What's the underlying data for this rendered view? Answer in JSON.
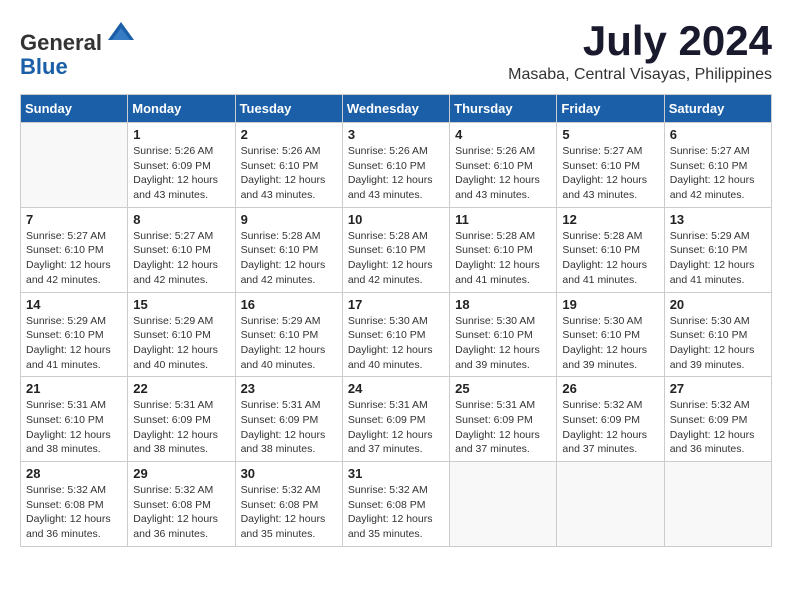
{
  "header": {
    "logo_line1": "General",
    "logo_line2": "Blue",
    "month_title": "July 2024",
    "location": "Masaba, Central Visayas, Philippines"
  },
  "weekdays": [
    "Sunday",
    "Monday",
    "Tuesday",
    "Wednesday",
    "Thursday",
    "Friday",
    "Saturday"
  ],
  "weeks": [
    [
      {
        "day": "",
        "sunrise": "",
        "sunset": "",
        "daylight": "",
        "empty": true
      },
      {
        "day": "1",
        "sunrise": "Sunrise: 5:26 AM",
        "sunset": "Sunset: 6:09 PM",
        "daylight": "Daylight: 12 hours and 43 minutes."
      },
      {
        "day": "2",
        "sunrise": "Sunrise: 5:26 AM",
        "sunset": "Sunset: 6:10 PM",
        "daylight": "Daylight: 12 hours and 43 minutes."
      },
      {
        "day": "3",
        "sunrise": "Sunrise: 5:26 AM",
        "sunset": "Sunset: 6:10 PM",
        "daylight": "Daylight: 12 hours and 43 minutes."
      },
      {
        "day": "4",
        "sunrise": "Sunrise: 5:26 AM",
        "sunset": "Sunset: 6:10 PM",
        "daylight": "Daylight: 12 hours and 43 minutes."
      },
      {
        "day": "5",
        "sunrise": "Sunrise: 5:27 AM",
        "sunset": "Sunset: 6:10 PM",
        "daylight": "Daylight: 12 hours and 43 minutes."
      },
      {
        "day": "6",
        "sunrise": "Sunrise: 5:27 AM",
        "sunset": "Sunset: 6:10 PM",
        "daylight": "Daylight: 12 hours and 42 minutes."
      }
    ],
    [
      {
        "day": "7",
        "sunrise": "Sunrise: 5:27 AM",
        "sunset": "Sunset: 6:10 PM",
        "daylight": "Daylight: 12 hours and 42 minutes."
      },
      {
        "day": "8",
        "sunrise": "Sunrise: 5:27 AM",
        "sunset": "Sunset: 6:10 PM",
        "daylight": "Daylight: 12 hours and 42 minutes."
      },
      {
        "day": "9",
        "sunrise": "Sunrise: 5:28 AM",
        "sunset": "Sunset: 6:10 PM",
        "daylight": "Daylight: 12 hours and 42 minutes."
      },
      {
        "day": "10",
        "sunrise": "Sunrise: 5:28 AM",
        "sunset": "Sunset: 6:10 PM",
        "daylight": "Daylight: 12 hours and 42 minutes."
      },
      {
        "day": "11",
        "sunrise": "Sunrise: 5:28 AM",
        "sunset": "Sunset: 6:10 PM",
        "daylight": "Daylight: 12 hours and 41 minutes."
      },
      {
        "day": "12",
        "sunrise": "Sunrise: 5:28 AM",
        "sunset": "Sunset: 6:10 PM",
        "daylight": "Daylight: 12 hours and 41 minutes."
      },
      {
        "day": "13",
        "sunrise": "Sunrise: 5:29 AM",
        "sunset": "Sunset: 6:10 PM",
        "daylight": "Daylight: 12 hours and 41 minutes."
      }
    ],
    [
      {
        "day": "14",
        "sunrise": "Sunrise: 5:29 AM",
        "sunset": "Sunset: 6:10 PM",
        "daylight": "Daylight: 12 hours and 41 minutes."
      },
      {
        "day": "15",
        "sunrise": "Sunrise: 5:29 AM",
        "sunset": "Sunset: 6:10 PM",
        "daylight": "Daylight: 12 hours and 40 minutes."
      },
      {
        "day": "16",
        "sunrise": "Sunrise: 5:29 AM",
        "sunset": "Sunset: 6:10 PM",
        "daylight": "Daylight: 12 hours and 40 minutes."
      },
      {
        "day": "17",
        "sunrise": "Sunrise: 5:30 AM",
        "sunset": "Sunset: 6:10 PM",
        "daylight": "Daylight: 12 hours and 40 minutes."
      },
      {
        "day": "18",
        "sunrise": "Sunrise: 5:30 AM",
        "sunset": "Sunset: 6:10 PM",
        "daylight": "Daylight: 12 hours and 39 minutes."
      },
      {
        "day": "19",
        "sunrise": "Sunrise: 5:30 AM",
        "sunset": "Sunset: 6:10 PM",
        "daylight": "Daylight: 12 hours and 39 minutes."
      },
      {
        "day": "20",
        "sunrise": "Sunrise: 5:30 AM",
        "sunset": "Sunset: 6:10 PM",
        "daylight": "Daylight: 12 hours and 39 minutes."
      }
    ],
    [
      {
        "day": "21",
        "sunrise": "Sunrise: 5:31 AM",
        "sunset": "Sunset: 6:10 PM",
        "daylight": "Daylight: 12 hours and 38 minutes."
      },
      {
        "day": "22",
        "sunrise": "Sunrise: 5:31 AM",
        "sunset": "Sunset: 6:09 PM",
        "daylight": "Daylight: 12 hours and 38 minutes."
      },
      {
        "day": "23",
        "sunrise": "Sunrise: 5:31 AM",
        "sunset": "Sunset: 6:09 PM",
        "daylight": "Daylight: 12 hours and 38 minutes."
      },
      {
        "day": "24",
        "sunrise": "Sunrise: 5:31 AM",
        "sunset": "Sunset: 6:09 PM",
        "daylight": "Daylight: 12 hours and 37 minutes."
      },
      {
        "day": "25",
        "sunrise": "Sunrise: 5:31 AM",
        "sunset": "Sunset: 6:09 PM",
        "daylight": "Daylight: 12 hours and 37 minutes."
      },
      {
        "day": "26",
        "sunrise": "Sunrise: 5:32 AM",
        "sunset": "Sunset: 6:09 PM",
        "daylight": "Daylight: 12 hours and 37 minutes."
      },
      {
        "day": "27",
        "sunrise": "Sunrise: 5:32 AM",
        "sunset": "Sunset: 6:09 PM",
        "daylight": "Daylight: 12 hours and 36 minutes."
      }
    ],
    [
      {
        "day": "28",
        "sunrise": "Sunrise: 5:32 AM",
        "sunset": "Sunset: 6:08 PM",
        "daylight": "Daylight: 12 hours and 36 minutes."
      },
      {
        "day": "29",
        "sunrise": "Sunrise: 5:32 AM",
        "sunset": "Sunset: 6:08 PM",
        "daylight": "Daylight: 12 hours and 36 minutes."
      },
      {
        "day": "30",
        "sunrise": "Sunrise: 5:32 AM",
        "sunset": "Sunset: 6:08 PM",
        "daylight": "Daylight: 12 hours and 35 minutes."
      },
      {
        "day": "31",
        "sunrise": "Sunrise: 5:32 AM",
        "sunset": "Sunset: 6:08 PM",
        "daylight": "Daylight: 12 hours and 35 minutes."
      },
      {
        "day": "",
        "sunrise": "",
        "sunset": "",
        "daylight": "",
        "empty": true
      },
      {
        "day": "",
        "sunrise": "",
        "sunset": "",
        "daylight": "",
        "empty": true
      },
      {
        "day": "",
        "sunrise": "",
        "sunset": "",
        "daylight": "",
        "empty": true
      }
    ]
  ]
}
